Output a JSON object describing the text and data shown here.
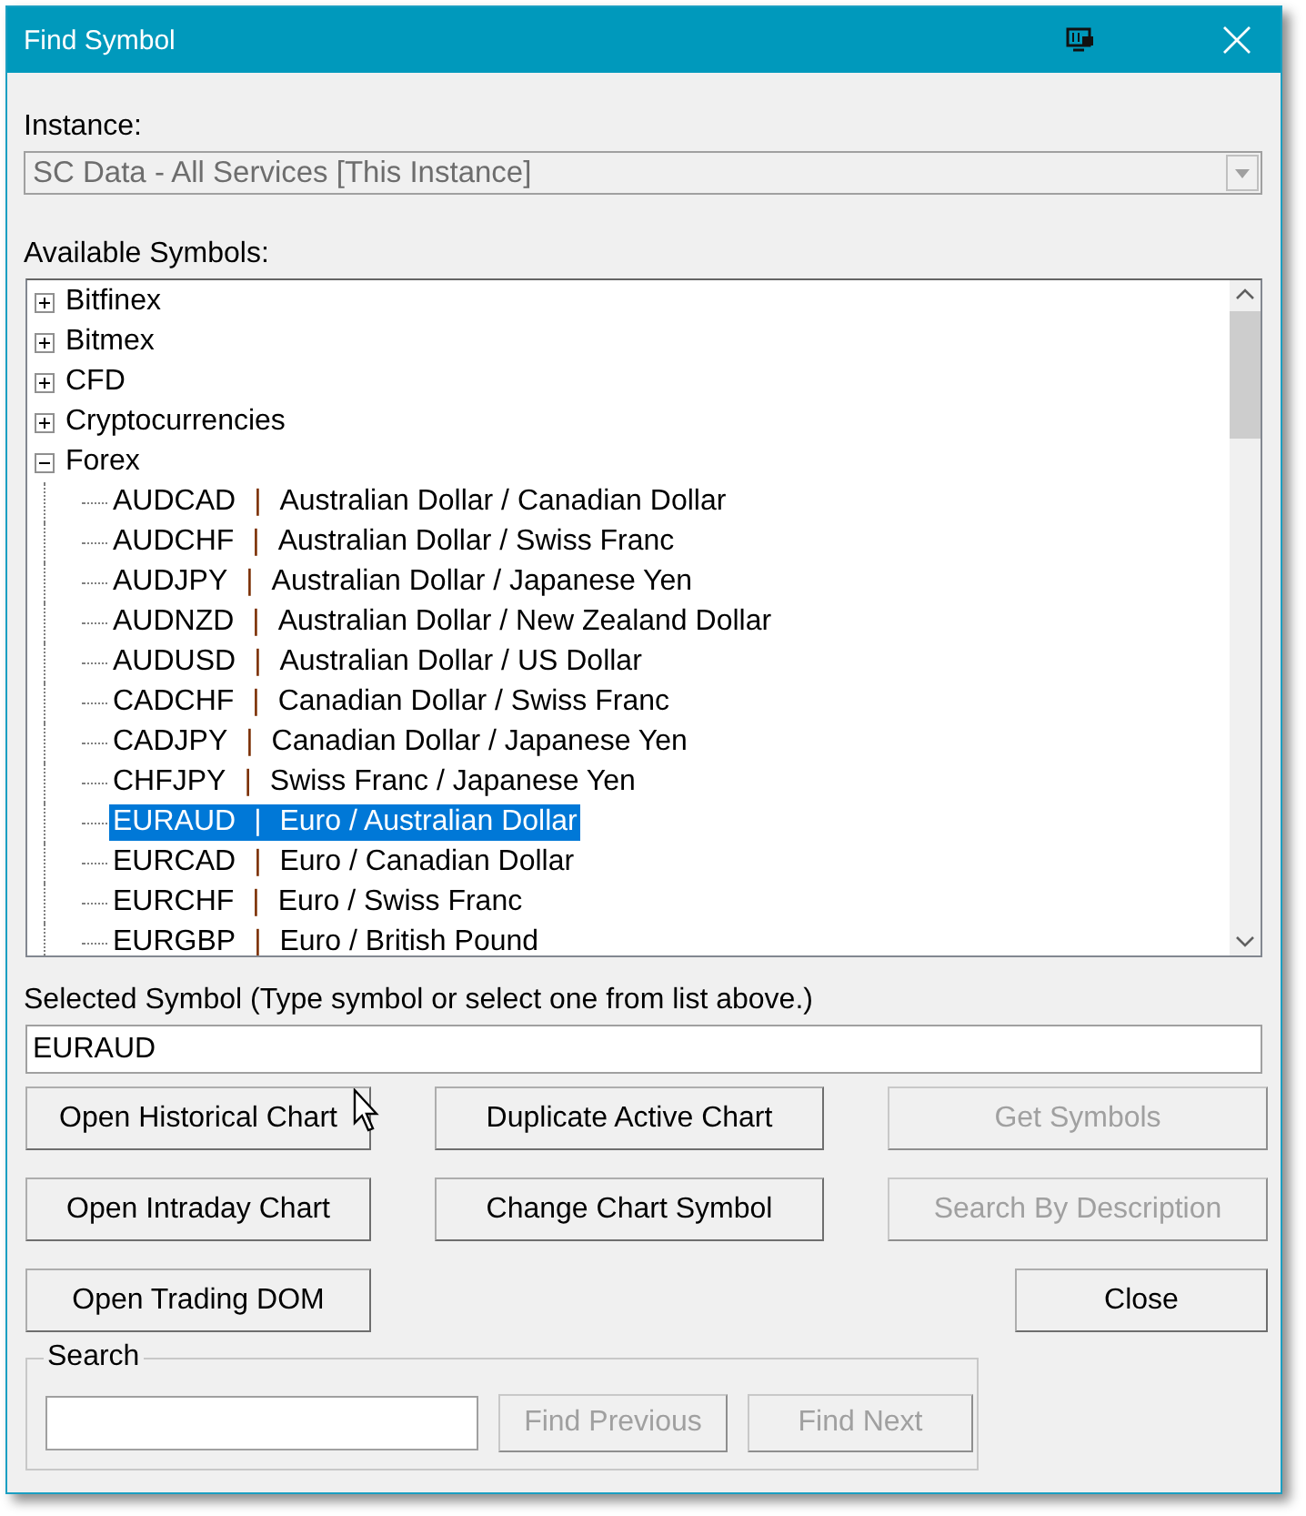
{
  "window": {
    "title": "Find Symbol"
  },
  "instance": {
    "label": "Instance:",
    "value": "SC Data - All Services [This Instance]",
    "disabled": true
  },
  "symbols": {
    "label": "Available Symbols:",
    "tree": [
      {
        "label": "Bitfinex",
        "expanded": false
      },
      {
        "label": "Bitmex",
        "expanded": false
      },
      {
        "label": "CFD",
        "expanded": false
      },
      {
        "label": "Cryptocurrencies",
        "expanded": false
      },
      {
        "label": "Forex",
        "expanded": true,
        "children": [
          {
            "symbol": "AUDCAD",
            "separator": "|",
            "description": "Australian Dollar / Canadian Dollar",
            "selected": false
          },
          {
            "symbol": "AUDCHF",
            "separator": "|",
            "description": "Australian Dollar / Swiss Franc",
            "selected": false
          },
          {
            "symbol": "AUDJPY",
            "separator": "|",
            "description": "Australian Dollar / Japanese Yen",
            "selected": false
          },
          {
            "symbol": "AUDNZD",
            "separator": "|",
            "description": "Australian Dollar / New Zealand Dollar",
            "selected": false
          },
          {
            "symbol": "AUDUSD",
            "separator": "|",
            "description": "Australian Dollar / US Dollar",
            "selected": false
          },
          {
            "symbol": "CADCHF",
            "separator": "|",
            "description": "Canadian Dollar / Swiss Franc",
            "selected": false
          },
          {
            "symbol": "CADJPY",
            "separator": "|",
            "description": "Canadian Dollar / Japanese Yen",
            "selected": false
          },
          {
            "symbol": "CHFJPY",
            "separator": "|",
            "description": "Swiss Franc / Japanese Yen",
            "selected": false
          },
          {
            "symbol": "EURAUD",
            "separator": "|",
            "description": "Euro / Australian Dollar",
            "selected": true
          },
          {
            "symbol": "EURCAD",
            "separator": "|",
            "description": "Euro / Canadian Dollar",
            "selected": false
          },
          {
            "symbol": "EURCHF",
            "separator": "|",
            "description": "Euro / Swiss Franc",
            "selected": false
          },
          {
            "symbol": "EURGBP",
            "separator": "|",
            "description": "Euro / British Pound",
            "selected": false
          }
        ]
      }
    ]
  },
  "selected_symbol": {
    "label": "Selected Symbol (Type symbol or select one from list above.)",
    "value": "EURAUD"
  },
  "buttons": [
    {
      "label": "Open Historical Chart",
      "disabled": false
    },
    {
      "label": "Duplicate Active Chart",
      "disabled": false
    },
    {
      "label": "Get Symbols",
      "disabled": true
    },
    {
      "label": "Open Intraday Chart",
      "disabled": false
    },
    {
      "label": "Change Chart Symbol",
      "disabled": false
    },
    {
      "label": "Search By Description",
      "disabled": true
    },
    {
      "label": "Open Trading DOM",
      "disabled": false
    },
    {
      "label": "Close",
      "disabled": false
    }
  ],
  "search": {
    "label": "Search",
    "buttons": [
      {
        "label": "Find Previous",
        "disabled": true
      },
      {
        "label": "Find Next",
        "disabled": true
      }
    ]
  }
}
